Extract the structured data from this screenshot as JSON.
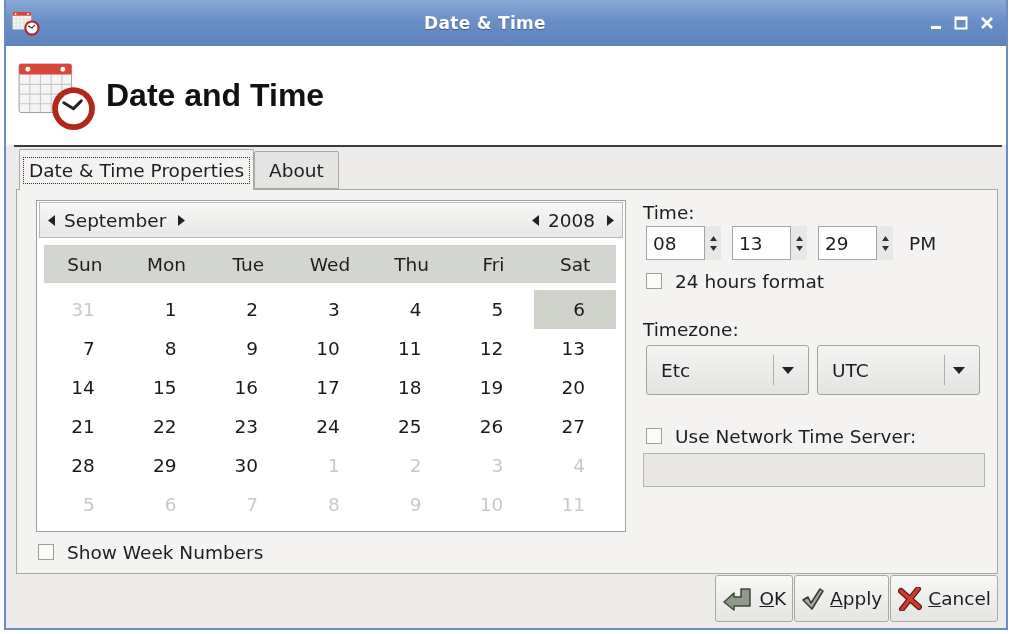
{
  "window": {
    "title": "Date & Time"
  },
  "header": {
    "title": "Date and Time"
  },
  "tabs": [
    {
      "label": "Date & Time Properties",
      "selected": true,
      "focused": true
    },
    {
      "label": "About",
      "selected": false,
      "focused": false
    }
  ],
  "calendar": {
    "month": "September",
    "year": "2008",
    "weekdays": [
      "Sun",
      "Mon",
      "Tue",
      "Wed",
      "Thu",
      "Fri",
      "Sat"
    ],
    "weeks": [
      [
        {
          "day": "31",
          "dimmed": true,
          "selected": false
        },
        {
          "day": "1",
          "dimmed": false,
          "selected": false
        },
        {
          "day": "2",
          "dimmed": false,
          "selected": false
        },
        {
          "day": "3",
          "dimmed": false,
          "selected": false
        },
        {
          "day": "4",
          "dimmed": false,
          "selected": false
        },
        {
          "day": "5",
          "dimmed": false,
          "selected": false
        },
        {
          "day": "6",
          "dimmed": false,
          "selected": true
        }
      ],
      [
        {
          "day": "7",
          "dimmed": false,
          "selected": false
        },
        {
          "day": "8",
          "dimmed": false,
          "selected": false
        },
        {
          "day": "9",
          "dimmed": false,
          "selected": false
        },
        {
          "day": "10",
          "dimmed": false,
          "selected": false
        },
        {
          "day": "11",
          "dimmed": false,
          "selected": false
        },
        {
          "day": "12",
          "dimmed": false,
          "selected": false
        },
        {
          "day": "13",
          "dimmed": false,
          "selected": false
        }
      ],
      [
        {
          "day": "14",
          "dimmed": false,
          "selected": false
        },
        {
          "day": "15",
          "dimmed": false,
          "selected": false
        },
        {
          "day": "16",
          "dimmed": false,
          "selected": false
        },
        {
          "day": "17",
          "dimmed": false,
          "selected": false
        },
        {
          "day": "18",
          "dimmed": false,
          "selected": false
        },
        {
          "day": "19",
          "dimmed": false,
          "selected": false
        },
        {
          "day": "20",
          "dimmed": false,
          "selected": false
        }
      ],
      [
        {
          "day": "21",
          "dimmed": false,
          "selected": false
        },
        {
          "day": "22",
          "dimmed": false,
          "selected": false
        },
        {
          "day": "23",
          "dimmed": false,
          "selected": false
        },
        {
          "day": "24",
          "dimmed": false,
          "selected": false
        },
        {
          "day": "25",
          "dimmed": false,
          "selected": false
        },
        {
          "day": "26",
          "dimmed": false,
          "selected": false
        },
        {
          "day": "27",
          "dimmed": false,
          "selected": false
        }
      ],
      [
        {
          "day": "28",
          "dimmed": false,
          "selected": false
        },
        {
          "day": "29",
          "dimmed": false,
          "selected": false
        },
        {
          "day": "30",
          "dimmed": false,
          "selected": false
        },
        {
          "day": "1",
          "dimmed": true,
          "selected": false
        },
        {
          "day": "2",
          "dimmed": true,
          "selected": false
        },
        {
          "day": "3",
          "dimmed": true,
          "selected": false
        },
        {
          "day": "4",
          "dimmed": true,
          "selected": false
        }
      ],
      [
        {
          "day": "5",
          "dimmed": true,
          "selected": false
        },
        {
          "day": "6",
          "dimmed": true,
          "selected": false
        },
        {
          "day": "7",
          "dimmed": true,
          "selected": false
        },
        {
          "day": "8",
          "dimmed": true,
          "selected": false
        },
        {
          "day": "9",
          "dimmed": true,
          "selected": false
        },
        {
          "day": "10",
          "dimmed": true,
          "selected": false
        },
        {
          "day": "11",
          "dimmed": true,
          "selected": false
        }
      ]
    ]
  },
  "show_week_numbers": {
    "label": "Show Week Numbers",
    "checked": false
  },
  "time": {
    "label": "Time:",
    "fields": [
      "08",
      "13",
      "29"
    ],
    "meridiem": "PM"
  },
  "hours_format": {
    "label": "24 hours format",
    "checked": false
  },
  "timezone": {
    "label": "Timezone:",
    "choices": [
      "Etc",
      "UTC"
    ]
  },
  "network_time": {
    "label": "Use Network Time Server:",
    "checked": false,
    "server": {
      "disabled": true
    }
  },
  "buttons": [
    {
      "label": "OK",
      "kind": "ok",
      "mnemonic": true
    },
    {
      "label": "Apply",
      "kind": "apply",
      "mnemonic": true
    },
    {
      "label": "Cancel",
      "kind": "cancel",
      "mnemonic": true
    }
  ]
}
